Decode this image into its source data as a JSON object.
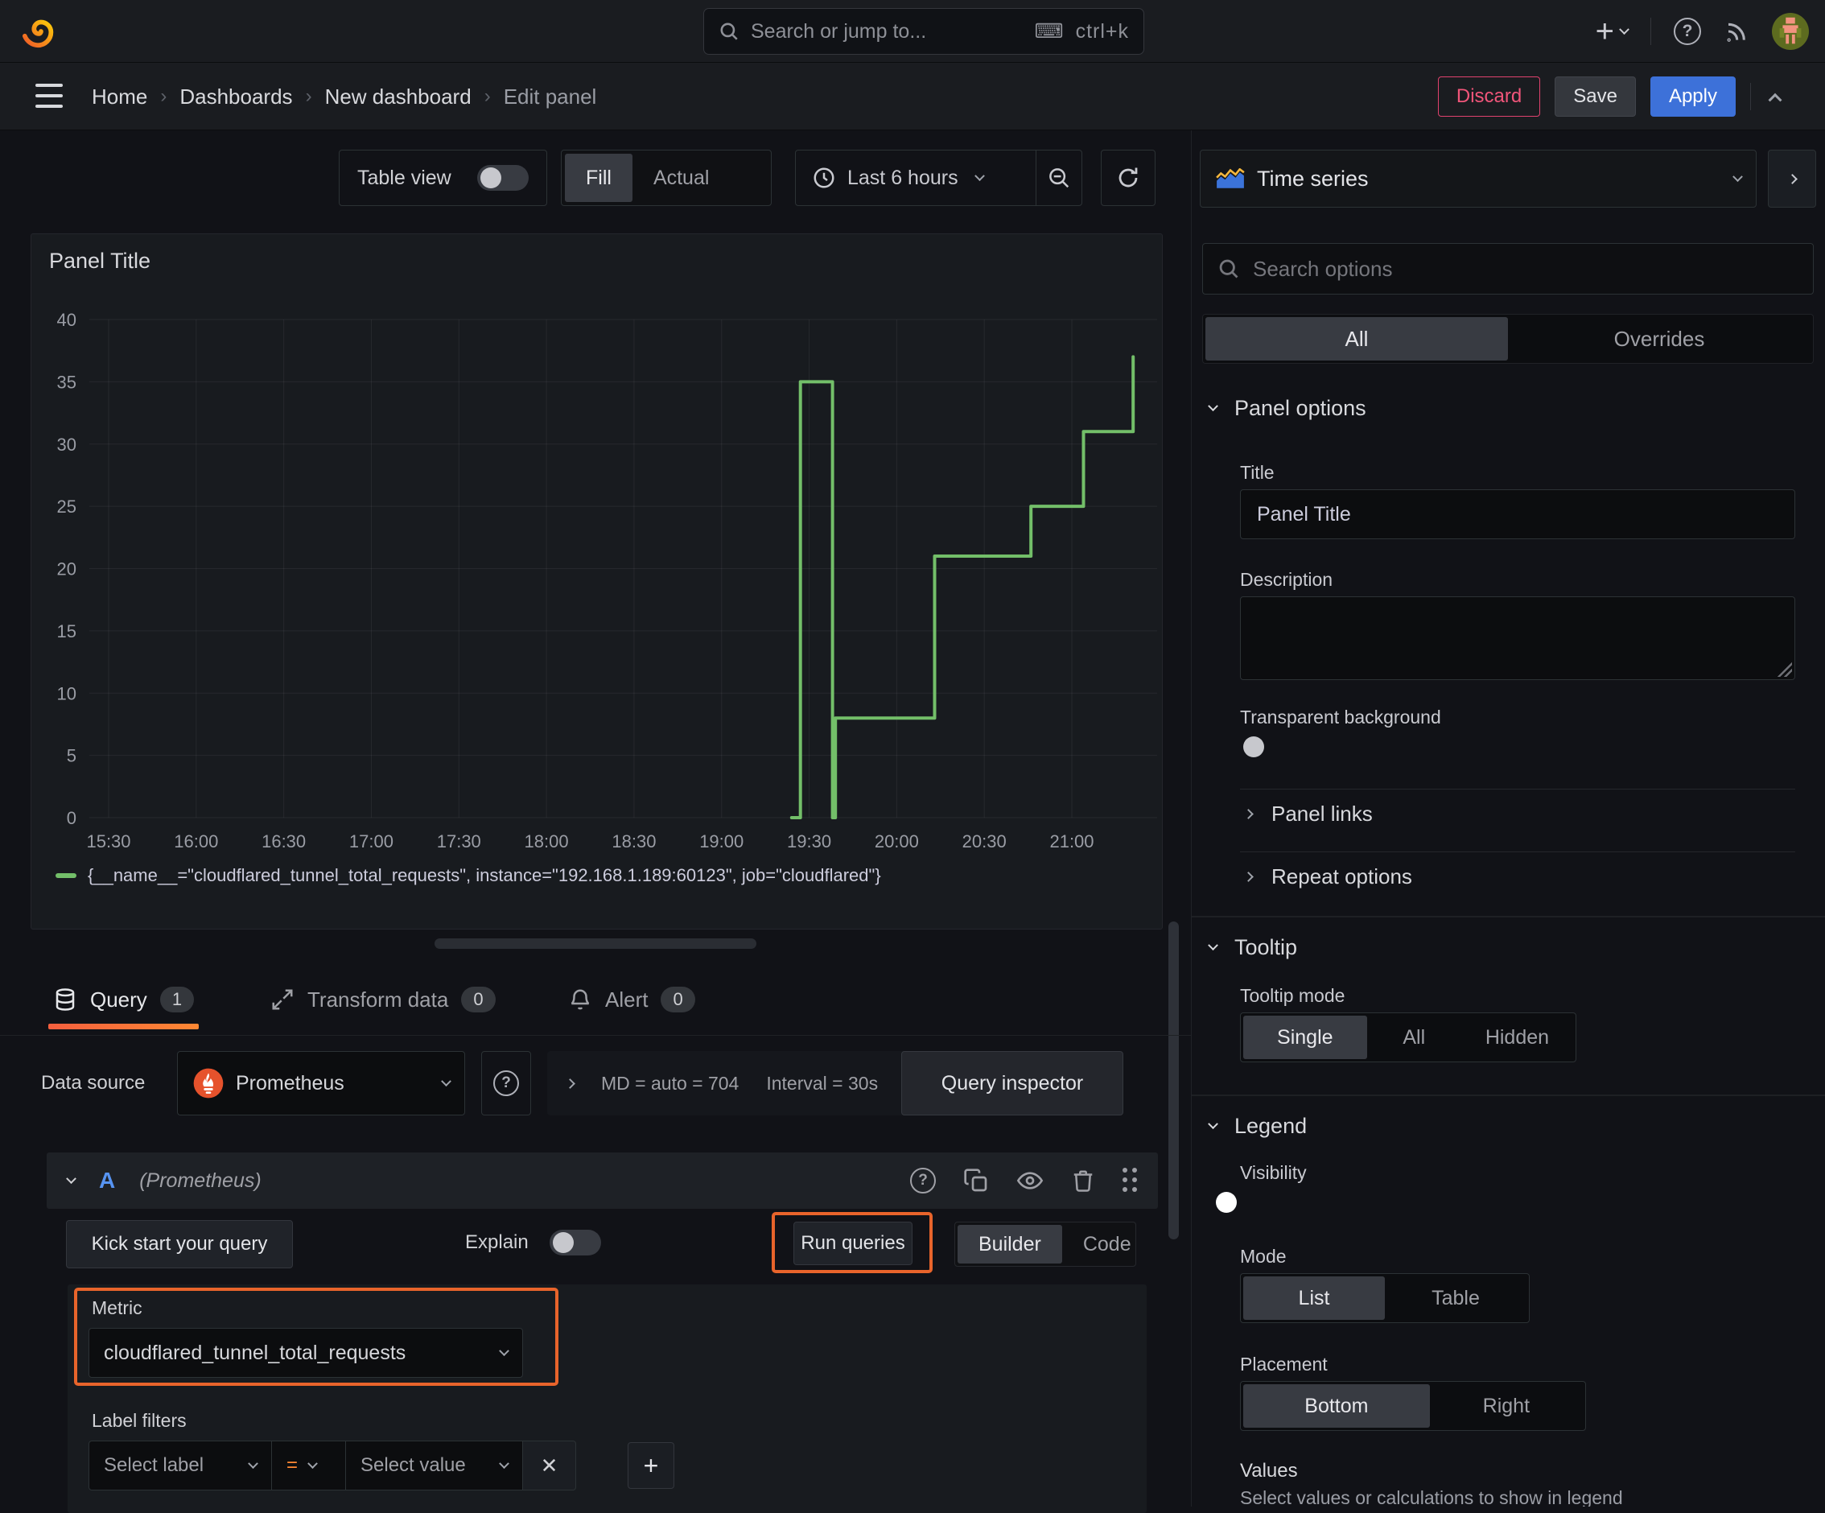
{
  "topbar": {
    "search_placeholder": "Search or jump to...",
    "shortcut": "ctrl+k"
  },
  "breadcrumb": {
    "items": [
      "Home",
      "Dashboards",
      "New dashboard",
      "Edit panel"
    ],
    "separator": "›",
    "discard": "Discard",
    "save": "Save",
    "apply": "Apply"
  },
  "toolbar": {
    "table_view": "Table view",
    "fill": "Fill",
    "actual": "Actual",
    "time_range": "Last 6 hours"
  },
  "panel": {
    "title": "Panel Title"
  },
  "chart_data": {
    "type": "line",
    "title": "Panel Title",
    "line_style": "step-after",
    "ylim": [
      0,
      40
    ],
    "ytick_step": 5,
    "grid": true,
    "legend_position": "bottom",
    "xticks": [
      "15:30",
      "16:00",
      "16:30",
      "17:00",
      "17:30",
      "18:00",
      "18:30",
      "19:00",
      "19:30",
      "20:00",
      "20:30",
      "21:00"
    ],
    "series": [
      {
        "name": "{__name__=\"cloudflared_tunnel_total_requests\", instance=\"192.168.1.189:60123\", job=\"cloudflared\"}",
        "color": "#73bf69",
        "step_vertices": [
          [
            "19:24",
            0
          ],
          [
            "19:27",
            0
          ],
          [
            "19:27",
            35
          ],
          [
            "19:38",
            35
          ],
          [
            "19:38",
            0
          ],
          [
            "19:39",
            0
          ],
          [
            "19:39",
            8
          ],
          [
            "20:13",
            8
          ],
          [
            "20:13",
            21
          ],
          [
            "20:46",
            21
          ],
          [
            "20:46",
            25
          ],
          [
            "21:04",
            25
          ],
          [
            "21:04",
            31
          ],
          [
            "21:21",
            31
          ],
          [
            "21:21",
            37
          ]
        ]
      }
    ]
  },
  "tabs": {
    "query": {
      "label": "Query",
      "count": "1"
    },
    "transform": {
      "label": "Transform data",
      "count": "0"
    },
    "alert": {
      "label": "Alert",
      "count": "0"
    }
  },
  "datasource": {
    "label": "Data source",
    "name": "Prometheus",
    "stat_md": "MD = auto = 704",
    "stat_interval": "Interval = 30s",
    "inspector": "Query inspector"
  },
  "query": {
    "ref": "A",
    "ds_hint": "(Prometheus)",
    "kickstart": "Kick start your query",
    "explain": "Explain",
    "run": "Run queries",
    "builder": "Builder",
    "code": "Code",
    "metric_label": "Metric",
    "metric_value": "cloudflared_tunnel_total_requests",
    "label_filters": "Label filters",
    "select_label": "Select label",
    "operator": "=",
    "select_value": "Select value"
  },
  "sidebar": {
    "viz_name": "Time series",
    "search_placeholder": "Search options",
    "tab_all": "All",
    "tab_overrides": "Overrides",
    "panel_options": "Panel options",
    "title_label": "Title",
    "title_value": "Panel Title",
    "description_label": "Description",
    "transparent": "Transparent background",
    "panel_links": "Panel links",
    "repeat_options": "Repeat options",
    "tooltip": "Tooltip",
    "tooltip_mode": "Tooltip mode",
    "mode_single": "Single",
    "mode_all": "All",
    "mode_hidden": "Hidden",
    "legend": "Legend",
    "visibility": "Visibility",
    "mode": "Mode",
    "mode_list": "List",
    "mode_table": "Table",
    "placement": "Placement",
    "placement_bottom": "Bottom",
    "placement_right": "Right",
    "values": "Values",
    "values_hint": "Select values or calculations to show in legend"
  },
  "glyphs": {
    "question": "?",
    "plus": "+",
    "close": "✕",
    "keyboard": "⌨"
  },
  "colors": {
    "accent_blue": "#3d71d9",
    "ref_blue": "#5794f2",
    "series_green": "#73bf69",
    "annotation_orange": "#e8642b",
    "tab_gradient": "#f55f3e → #ff8833",
    "danger_red": "#e0426e",
    "operator_orange": "#ff8833"
  }
}
